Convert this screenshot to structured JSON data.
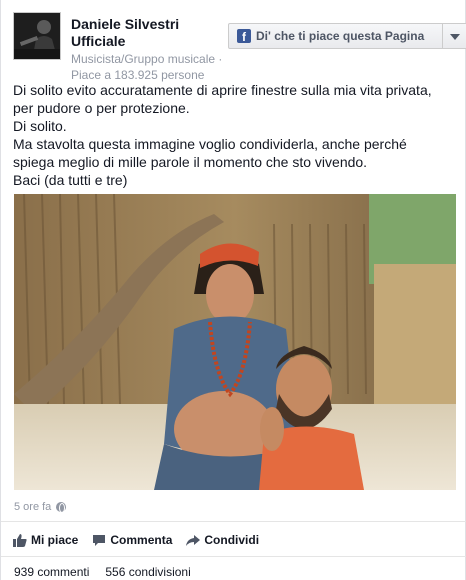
{
  "page": {
    "name": "Daniele Silvestri Ufficiale",
    "category": "Musicista/Gruppo musicale ·",
    "likes": "Piace a 183.925 persone"
  },
  "like_page_button": {
    "label": "Di' che ti piace questa Pagina",
    "brand_color": "#3b5998"
  },
  "post": {
    "text_lines": [
      "Di solito evito accuratamente di aprire finestre sulla mia vita privata,",
      "per pudore o per protezione.",
      "Di solito.",
      "Ma stavolta questa immagine voglio condividerla, anche perché",
      "spiega meglio di mille parole il momento che sto vivendo.",
      "Baci (da tutti e tre)"
    ],
    "timestamp": "5 ore fa"
  },
  "actions": {
    "like": "Mi piace",
    "comment": "Commenta",
    "share": "Condividi"
  },
  "stats": {
    "comments": "939 commenti",
    "shares": "556 condivisioni"
  }
}
